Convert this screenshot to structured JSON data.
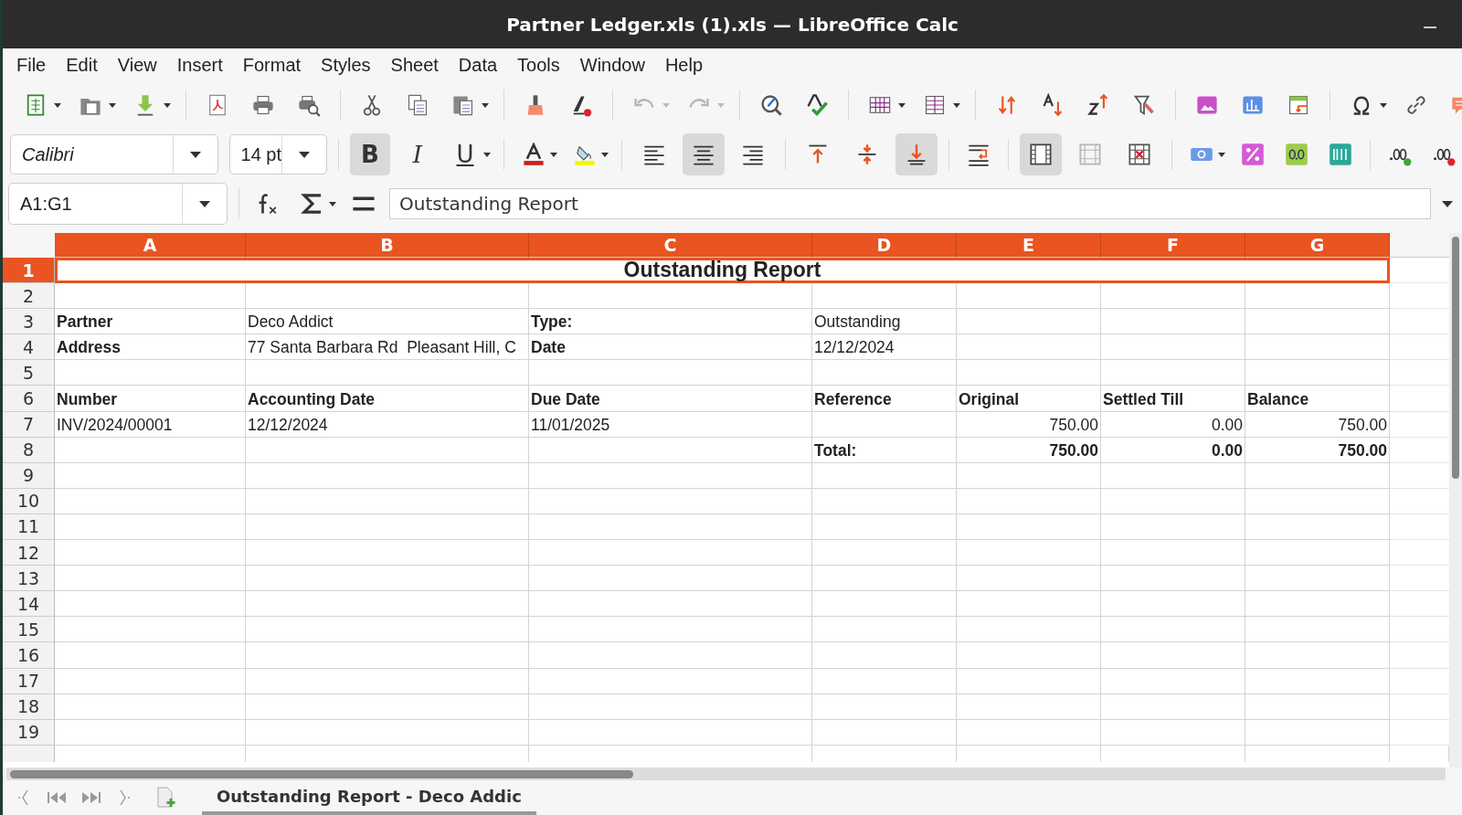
{
  "window": {
    "title": "Partner Ledger.xls (1).xls — LibreOffice Calc"
  },
  "menu": [
    "File",
    "Edit",
    "View",
    "Insert",
    "Format",
    "Styles",
    "Sheet",
    "Data",
    "Tools",
    "Window",
    "Help"
  ],
  "history_buttons": [
    {
      "kind": "undo",
      "disabled": true
    },
    {
      "kind": "redo",
      "disabled": true
    }
  ],
  "font_name": "Calibri",
  "font_size": "14 pt",
  "format_buttons": [
    {
      "kind": "bold",
      "label": "B",
      "selected": true
    },
    {
      "kind": "italic",
      "label": "I",
      "selected": false
    },
    {
      "kind": "underline",
      "label": "U",
      "selected": false
    }
  ],
  "alignment": [
    {
      "kind": "left",
      "selected": false
    },
    {
      "kind": "center",
      "selected": true
    },
    {
      "kind": "right",
      "selected": false
    }
  ],
  "vertical_alignment": [
    {
      "kind": "top",
      "selected": false
    },
    {
      "kind": "middle",
      "selected": false
    },
    {
      "kind": "bottom",
      "selected": true
    }
  ],
  "merge_buttons": [
    {
      "kind": "merge-center",
      "selected": true,
      "disabled": false
    },
    {
      "kind": "merge",
      "selected": false,
      "disabled": true
    },
    {
      "kind": "unmerge",
      "selected": false,
      "disabled": false
    }
  ],
  "name_box": "A1:G1",
  "formula": "Outstanding Report",
  "columns": [
    {
      "label": "A",
      "selected": true
    },
    {
      "label": "B",
      "selected": true
    },
    {
      "label": "C",
      "selected": true
    },
    {
      "label": "D",
      "selected": true
    },
    {
      "label": "E",
      "selected": true
    },
    {
      "label": "F",
      "selected": true
    },
    {
      "label": "G",
      "selected": true
    }
  ],
  "rows": [
    {
      "number": "1",
      "selected": true,
      "kind": "merged",
      "title": "Outstanding Report"
    },
    {
      "number": "2",
      "selected": false
    },
    {
      "number": "3",
      "selected": false,
      "cells": [
        {
          "text": "Partner",
          "bold": true,
          "kind": "text"
        },
        {
          "text": "Deco Addict",
          "bold": false,
          "kind": "text"
        },
        {
          "text": "Type:",
          "bold": true,
          "kind": "text"
        },
        {
          "text": "Outstanding",
          "bold": false,
          "kind": "text"
        },
        null,
        null,
        null
      ]
    },
    {
      "number": "4",
      "selected": false,
      "cells": [
        {
          "text": "Address",
          "bold": true,
          "kind": "text"
        },
        {
          "text": "77 Santa Barbara Rd  Pleasant Hill, C",
          "bold": false,
          "kind": "text"
        },
        {
          "text": "Date",
          "bold": true,
          "kind": "text"
        },
        {
          "text": "12/12/2024",
          "bold": false,
          "kind": "text"
        },
        null,
        null,
        null
      ]
    },
    {
      "number": "5",
      "selected": false
    },
    {
      "number": "6",
      "selected": false,
      "cells": [
        {
          "text": "Number",
          "bold": true,
          "kind": "text"
        },
        {
          "text": "Accounting Date",
          "bold": true,
          "kind": "text"
        },
        {
          "text": "Due Date",
          "bold": true,
          "kind": "text"
        },
        {
          "text": "Reference",
          "bold": true,
          "kind": "text"
        },
        {
          "text": "Original",
          "bold": true,
          "kind": "text"
        },
        {
          "text": "Settled Till",
          "bold": true,
          "kind": "text"
        },
        {
          "text": "Balance",
          "bold": true,
          "kind": "text"
        }
      ]
    },
    {
      "number": "7",
      "selected": false,
      "cells": [
        {
          "text": "INV/2024/00001",
          "bold": false,
          "kind": "text"
        },
        {
          "text": "12/12/2024",
          "bold": false,
          "kind": "text"
        },
        {
          "text": "11/01/2025",
          "bold": false,
          "kind": "text"
        },
        null,
        {
          "text": "750.00",
          "bold": false,
          "kind": "number"
        },
        {
          "text": "0.00",
          "bold": false,
          "kind": "number"
        },
        {
          "text": "750.00",
          "bold": false,
          "kind": "number"
        }
      ]
    },
    {
      "number": "8",
      "selected": false,
      "cells": [
        null,
        null,
        null,
        {
          "text": "Total:",
          "bold": true,
          "kind": "text"
        },
        {
          "text": "750.00",
          "bold": true,
          "kind": "number"
        },
        {
          "text": "0.00",
          "bold": true,
          "kind": "number"
        },
        {
          "text": "750.00",
          "bold": true,
          "kind": "number"
        }
      ]
    },
    {
      "number": "9",
      "selected": false
    },
    {
      "number": "10",
      "selected": false
    },
    {
      "number": "11",
      "selected": false
    },
    {
      "number": "12",
      "selected": false
    },
    {
      "number": "13",
      "selected": false
    },
    {
      "number": "14",
      "selected": false
    },
    {
      "number": "15",
      "selected": false
    },
    {
      "number": "16",
      "selected": false
    },
    {
      "number": "17",
      "selected": false
    },
    {
      "number": "18",
      "selected": false
    },
    {
      "number": "19",
      "selected": false
    }
  ],
  "sheet_tabs": [
    {
      "label": "Outstanding Report - Deco Addic",
      "selected": true
    }
  ]
}
